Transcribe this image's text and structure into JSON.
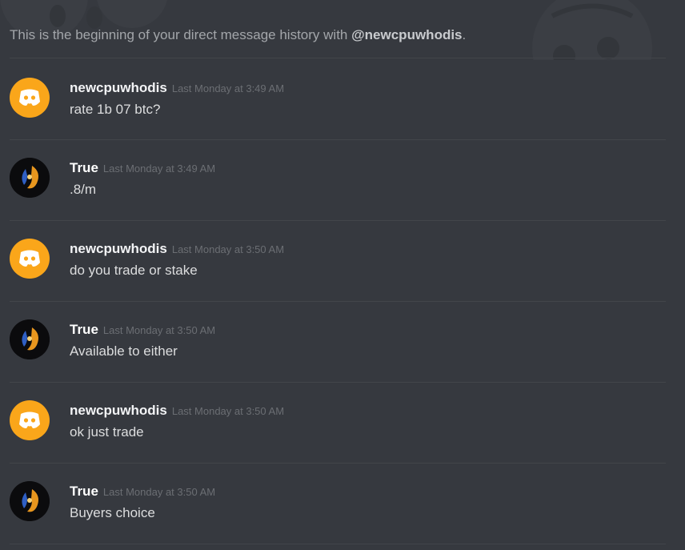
{
  "header": {
    "intro_text": "This is the beginning of your direct message history with ",
    "mention": "@newcpuwhodis",
    "end": "."
  },
  "messages": [
    {
      "author": "newcpuwhodis",
      "timestamp": "Last Monday at 3:49 AM",
      "content": "rate 1b 07 btc?",
      "avatar": "discord-logo"
    },
    {
      "author": "True",
      "timestamp": "Last Monday at 3:49 AM",
      "content": ".8/m",
      "avatar": "custom-orb"
    },
    {
      "author": "newcpuwhodis",
      "timestamp": "Last Monday at 3:50 AM",
      "content": "do you trade or stake",
      "avatar": "discord-logo"
    },
    {
      "author": "True",
      "timestamp": "Last Monday at 3:50 AM",
      "content": "Available to either",
      "avatar": "custom-orb"
    },
    {
      "author": "newcpuwhodis",
      "timestamp": "Last Monday at 3:50 AM",
      "content": "ok just trade",
      "avatar": "discord-logo"
    },
    {
      "author": "True",
      "timestamp": "Last Monday at 3:50 AM",
      "content": "Buyers choice",
      "avatar": "custom-orb"
    }
  ],
  "colors": {
    "background": "#36393f",
    "discord_avatar": "#faa61a",
    "username": "#ffffff",
    "timestamp": "#6b6e73",
    "text": "#dcddde"
  }
}
